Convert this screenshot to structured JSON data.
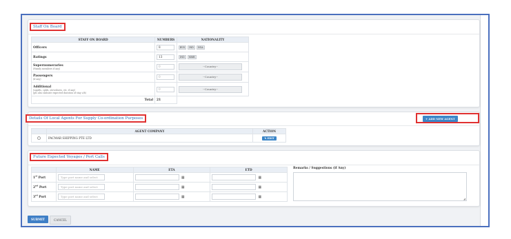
{
  "staff_panel": {
    "title": "Staff On Board",
    "headers": {
      "staff": "STAFF ON BOARD",
      "numbers": "NUMBERS",
      "nationality": "NATIONALITY"
    },
    "rows": [
      {
        "label": "Officers",
        "sub": "",
        "value": "8",
        "placeholder": "",
        "tags": [
          "BUS",
          "IND",
          "NGA"
        ],
        "country": ""
      },
      {
        "label": "Ratings",
        "sub": "",
        "value": "13",
        "placeholder": "",
        "tags": [
          "IND",
          "MMR"
        ],
        "country": ""
      },
      {
        "label": "Supernumeraries",
        "sub": "(Family members if any)",
        "value": "",
        "placeholder": "0",
        "tags": [],
        "country": "--Country--"
      },
      {
        "label": "Passengers",
        "sub": "(if any)",
        "value": "",
        "placeholder": "0",
        "tags": [],
        "country": "--Country--"
      },
      {
        "label": "Additional",
        "sub": "(supdts, cplsh, stevedores, etc, if any)",
        "sub2": "(pls also indicate expected duration of stay o/b)",
        "value": "",
        "placeholder": "0",
        "tags": [],
        "country": "--Country--"
      }
    ],
    "total_label": "Total",
    "total_value": "21"
  },
  "agents_panel": {
    "title": "Details Of Local Agents For Supply Co-ordination Purposes",
    "add_button": "+ ADD NEW AGENT",
    "headers": {
      "company": "AGENT COMPANY",
      "action": "ACTION"
    },
    "rows": [
      {
        "company": "PACMAR SHIPPING PTE LTD",
        "edit": "✎ EDIT"
      }
    ]
  },
  "voyages_panel": {
    "title": "Future Expected Voyages / Port Calls",
    "headers": {
      "name": "NAME",
      "eta": "ETA",
      "etd": "ETD"
    },
    "ports": [
      {
        "num": "1",
        "suffix": "st",
        "word": "Port",
        "placeholder": "Type port name and select"
      },
      {
        "num": "2",
        "suffix": "nd",
        "word": "Port",
        "placeholder": "Type port name and select"
      },
      {
        "num": "3",
        "suffix": "rd",
        "word": "Port",
        "placeholder": "Type port name and select"
      }
    ],
    "remarks_label": "Remarks / Suggestions (if Any)"
  },
  "footer": {
    "submit": "SUBMIT",
    "cancel": "CANCEL"
  }
}
